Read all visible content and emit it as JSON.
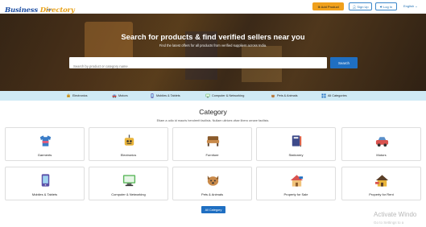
{
  "header": {
    "logo_main": "Business",
    "logo_accent": "Directory",
    "logo_sub": "app",
    "add_product_label": "Add Product",
    "sign_up_label": "Sign Up",
    "log_in_label": "Log In",
    "language": "English"
  },
  "hero": {
    "title": "Search for products & find verified sellers near you",
    "subtitle": "Find the latest offers for all products from verified suppliers across India.",
    "search_placeholder": "Search by product or category name",
    "search_button": "Search"
  },
  "quick_categories": [
    {
      "label": "Electronics",
      "icon": "robot-icon"
    },
    {
      "label": "Motors",
      "icon": "car-icon"
    },
    {
      "label": "Mobiles & Tablets",
      "icon": "mobile-icon"
    },
    {
      "label": "Computer & Networking",
      "icon": "computer-icon"
    },
    {
      "label": "Pets & Animals",
      "icon": "pets-icon"
    },
    {
      "label": "All Categories",
      "icon": "grid-icon"
    }
  ],
  "category_section": {
    "title": "Category",
    "description": "Etiam a odio id mauris hendrerit facilisis. Nullam ultrices vitae libero ornare facilisis."
  },
  "categories": [
    {
      "label": "Garments",
      "icon": "garments-icon"
    },
    {
      "label": "Electronics",
      "icon": "robot-icon"
    },
    {
      "label": "Furniture",
      "icon": "furniture-icon"
    },
    {
      "label": "Stationery",
      "icon": "stationery-icon"
    },
    {
      "label": "Motors",
      "icon": "car-icon"
    },
    {
      "label": "Mobiles & Tablets",
      "icon": "mobile-icon"
    },
    {
      "label": "Computer & Networking",
      "icon": "computer-icon"
    },
    {
      "label": "Pets & Animals",
      "icon": "pets-icon"
    },
    {
      "label": "Property for Sale",
      "icon": "house-sale-icon"
    },
    {
      "label": "Property for Rent",
      "icon": "house-rent-icon"
    }
  ],
  "all_category_button": "All Category",
  "watermark": {
    "line1": "Activate Windo",
    "line2": "Go to Settings to a"
  },
  "colors": {
    "primary": "#1f6fc2",
    "accent": "#f0a01c",
    "quickbar_bg": "#cfeaf5"
  }
}
